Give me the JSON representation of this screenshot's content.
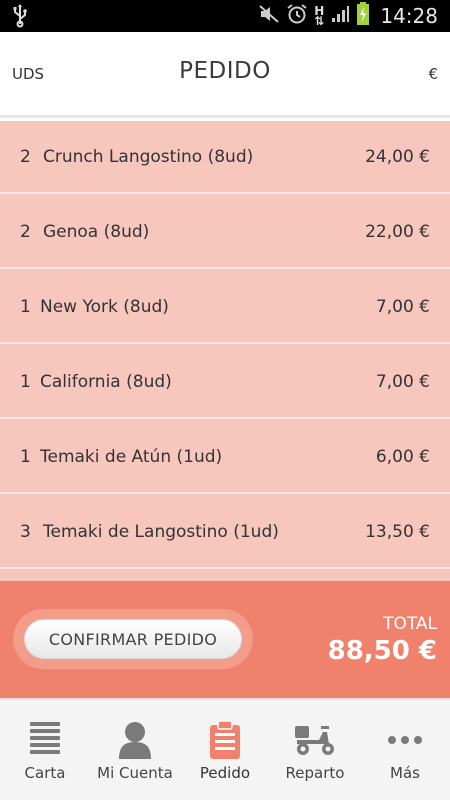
{
  "status_bar": {
    "time": "14:28"
  },
  "header": {
    "left_label": "UDS",
    "title": "PEDIDO",
    "right_label": "€"
  },
  "order_items": [
    {
      "qty": "2",
      "name": "Crunch Langostino (8ud)",
      "price": "24,00 €"
    },
    {
      "qty": "2",
      "name": "Genoa  (8ud)",
      "price": "22,00 €"
    },
    {
      "qty": "1",
      "name": "New York (8ud)",
      "price": "7,00 €"
    },
    {
      "qty": "1",
      "name": "California (8ud)",
      "price": "7,00 €"
    },
    {
      "qty": "1",
      "name": "Temaki de Atún (1ud)",
      "price": "6,00 €"
    },
    {
      "qty": "3",
      "name": "Temaki de Langostino (1ud)",
      "price": "13,50 €"
    }
  ],
  "footer": {
    "confirm_label": "CONFIRMAR PEDIDO",
    "total_label": "TOTAL",
    "total_value": "88,50 €"
  },
  "tabs": [
    {
      "label": "Carta",
      "icon": "menu-list-icon"
    },
    {
      "label": "Mi Cuenta",
      "icon": "person-icon"
    },
    {
      "label": "Pedido",
      "icon": "clipboard-icon",
      "active": true
    },
    {
      "label": "Reparto",
      "icon": "scooter-icon"
    },
    {
      "label": "Más",
      "icon": "more-dots-icon"
    }
  ],
  "colors": {
    "list_bg": "#f7c6bd",
    "footer_bg": "#f0826d",
    "active_tab": "#f0826d",
    "inactive_tab": "#7a7a7a"
  }
}
